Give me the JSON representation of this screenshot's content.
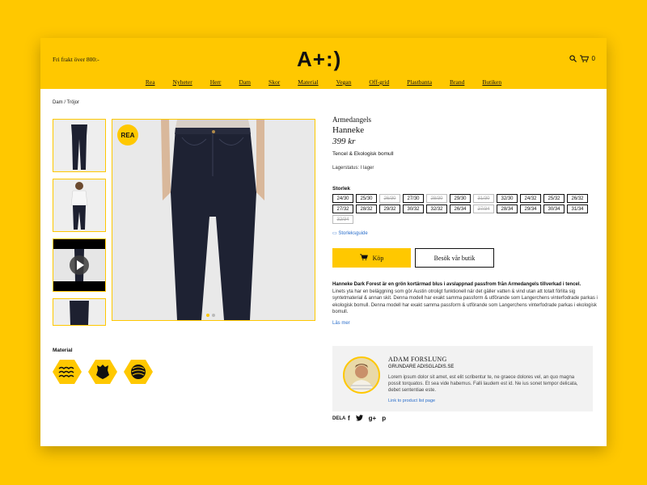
{
  "header": {
    "free_shipping": "Fri frakt över 800:-",
    "logo": "A+:)",
    "cart_count": "0",
    "nav": [
      "Rea",
      "Nyheter",
      "Herr",
      "Dam",
      "Skor",
      "Material",
      "Vegan",
      "Off-grid",
      "Plastbanta",
      "Brand",
      "Butiken"
    ]
  },
  "breadcrumb": "Dam  /  Tröjor",
  "gallery": {
    "badge": "REA"
  },
  "product": {
    "brand": "Armedangels",
    "name": "Hanneke",
    "price": "399 kr",
    "fabric": "Tencel & Ekologisk bomull",
    "stock": "Lagerstatus: I lager",
    "size_label": "Storlek",
    "sizes": [
      {
        "label": "24/30",
        "available": true
      },
      {
        "label": "25/30",
        "available": true
      },
      {
        "label": "26/30",
        "available": false
      },
      {
        "label": "27/30",
        "available": true
      },
      {
        "label": "28/30",
        "available": false
      },
      {
        "label": "29/30",
        "available": true
      },
      {
        "label": "31/30",
        "available": false
      },
      {
        "label": "32/30",
        "available": true
      },
      {
        "label": "24/32",
        "available": true
      },
      {
        "label": "25/32",
        "available": true
      },
      {
        "label": "26/32",
        "available": true
      },
      {
        "label": "27/32",
        "available": true
      },
      {
        "label": "28/32",
        "available": true
      },
      {
        "label": "29/32",
        "available": true
      },
      {
        "label": "30/32",
        "available": true
      },
      {
        "label": "32/32",
        "available": true
      },
      {
        "label": "26/34",
        "available": true
      },
      {
        "label": "27/34",
        "available": false
      },
      {
        "label": "28/34",
        "available": true
      },
      {
        "label": "29/34",
        "available": true
      },
      {
        "label": "30/34",
        "available": true
      },
      {
        "label": "31/34",
        "available": true
      },
      {
        "label": "32/34",
        "available": false
      }
    ],
    "size_guide": "Storleksguide",
    "buy_label": "Köp",
    "visit_label": "Besök vår butik",
    "desc_title": "Hanneke Dark Forest är en grön kortärmad blus i avslappnad passfrom från Armedangels tillverkad i tencel.",
    "desc_body": "Linets yta har en beläggning som gör Austin otroligt funktionell när det gäller vatten & vind utan att totalt förlita sig syntetmaterial & annan skit. Denna modell har exakt samma passform & utförande som Langerchens vinterfodrade parkas i ekologisk bomull. Denna modell har exakt samma passform & utförande som Langerchens vinterfodrade parkas i ekologisk bomull.",
    "read_more": "Läs mer",
    "material_label": "Material",
    "materials": [
      "wool-icon",
      "leather-icon",
      "yarn-icon"
    ],
    "share_label": "DELA",
    "share_icons": [
      "f",
      "t",
      "g+",
      "p"
    ]
  },
  "quote": {
    "name": "ADAM FORSLUNG",
    "role": "GRUNDARE ADISGLADIS.SE",
    "text": "Lorem ipsum dolor sit amet, est elit scribentur te, ne graece dolores vel, an quo magna possit torquatos. Et sea vide habemus. Falli laudem est id. Ne ius sonet tempor delicata, debet sententiae este.",
    "link": "Link to product list page"
  },
  "colors": {
    "accent": "#FFC800",
    "link": "#2a6ecb"
  }
}
